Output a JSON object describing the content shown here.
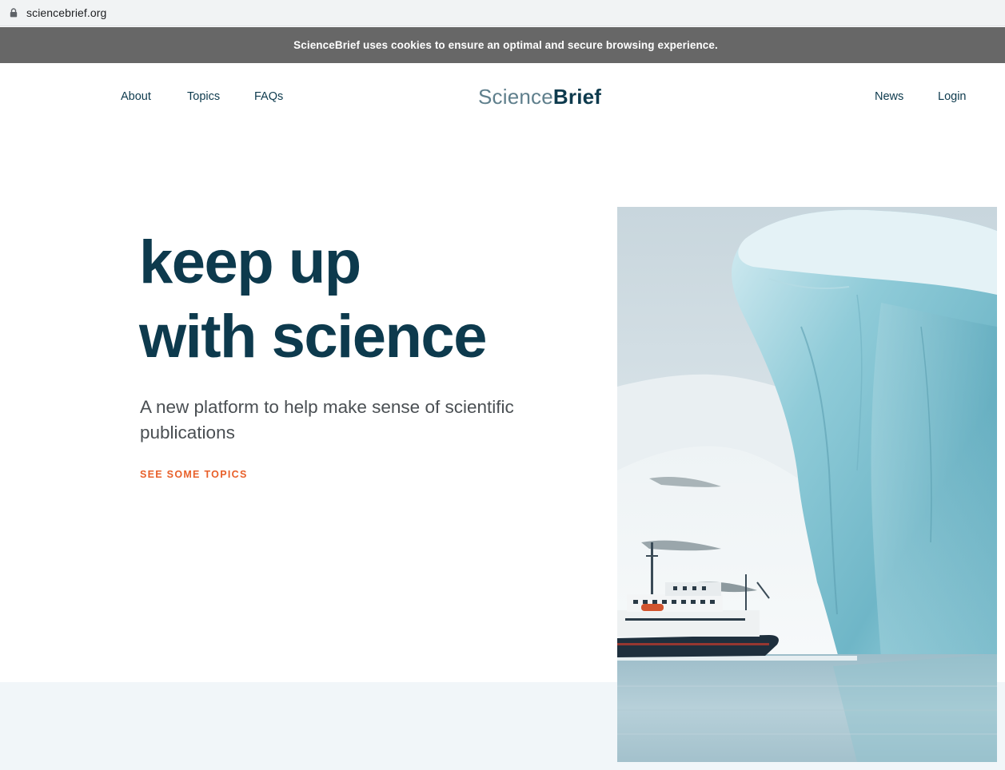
{
  "browser": {
    "url": "sciencebrief.org",
    "icon": "lock-icon"
  },
  "cookie_banner": {
    "text": "ScienceBrief uses cookies to ensure an optimal and secure browsing experience."
  },
  "nav": {
    "left": [
      {
        "label": "About"
      },
      {
        "label": "Topics"
      },
      {
        "label": "FAQs"
      }
    ],
    "logo": {
      "part1": "Science",
      "part2": "Brief"
    },
    "right": [
      {
        "label": "News"
      },
      {
        "label": "Login"
      }
    ]
  },
  "hero": {
    "headline_line1": "keep up",
    "headline_line2": "with science",
    "subtitle": "A new platform to help make sense of scientific publications",
    "cta_label": "SEE SOME TOPICS"
  },
  "colors": {
    "primary": "#0d3a4d",
    "accent": "#e8602a",
    "banner": "#676767",
    "band": "#f1f6f9"
  }
}
